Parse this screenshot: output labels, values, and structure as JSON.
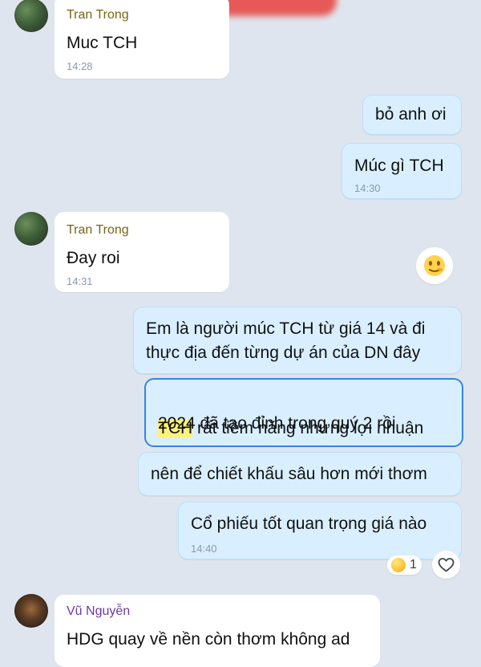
{
  "messages": [
    {
      "sender": "Tran Trong",
      "text": "Muc TCH",
      "time": "14:28"
    },
    {
      "text": "bỏ anh ơi"
    },
    {
      "text": "Múc gì TCH",
      "time": "14:30"
    },
    {
      "sender": "Tran Trong",
      "text": "Đay roi",
      "time": "14:31"
    },
    {
      "text_line1": "Em là người múc TCH từ giá 14 và đi",
      "text_line2": "thực địa đến từng dự án của DN đây"
    },
    {
      "highlight": "TCH",
      "text_line1_rest": " rất tiềm năng nhưng lợi nhuận",
      "text_line2": "2024 đã tạo đỉnh trong quý 2 rồi"
    },
    {
      "text": "nên để chiết khấu sâu hơn mới thơm"
    },
    {
      "text": "Cổ phiếu tốt quan trọng giá nào",
      "time": "14:40",
      "reaction_count": "1"
    },
    {
      "sender": "Vũ Nguyễn",
      "text": "HDG quay về nền còn thơm không ad"
    }
  ],
  "icons": {
    "reaction_emoji": "reaction-emoji-icon",
    "heart": "heart-icon"
  },
  "colors": {
    "background": "#dfe5ee",
    "incoming_bubble": "#ffffff",
    "outgoing_bubble": "#d9efff",
    "highlight_border": "#2f87e8",
    "tran_name": "#7a6415",
    "vu_name": "#6b3aa3"
  }
}
